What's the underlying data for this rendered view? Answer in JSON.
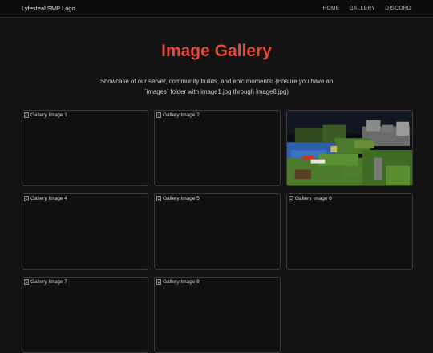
{
  "navbar": {
    "brand": "Lyfesteal SMP Logo",
    "links": [
      {
        "label": "HOME"
      },
      {
        "label": "GALLERY"
      },
      {
        "label": "DISCORD"
      }
    ]
  },
  "header": {
    "title": "Image Gallery",
    "subtitle": "Showcase of our server, community builds, and epic moments! (Ensure you have an `images` folder with image1.jpg through image8.jpg)"
  },
  "gallery": {
    "items": [
      {
        "alt": "Gallery Image 1",
        "loaded": false
      },
      {
        "alt": "Gallery Image 2",
        "loaded": false
      },
      {
        "alt": "Gallery Image 3",
        "loaded": true
      },
      {
        "alt": "Gallery Image 4",
        "loaded": false
      },
      {
        "alt": "Gallery Image 5",
        "loaded": false
      },
      {
        "alt": "Gallery Image 6",
        "loaded": false
      },
      {
        "alt": "Gallery Image 7",
        "loaded": false
      },
      {
        "alt": "Gallery Image 8",
        "loaded": false
      }
    ]
  },
  "colors": {
    "accent": "#e8493a",
    "background": "#131313",
    "tile_border": "#3a3a3a"
  }
}
